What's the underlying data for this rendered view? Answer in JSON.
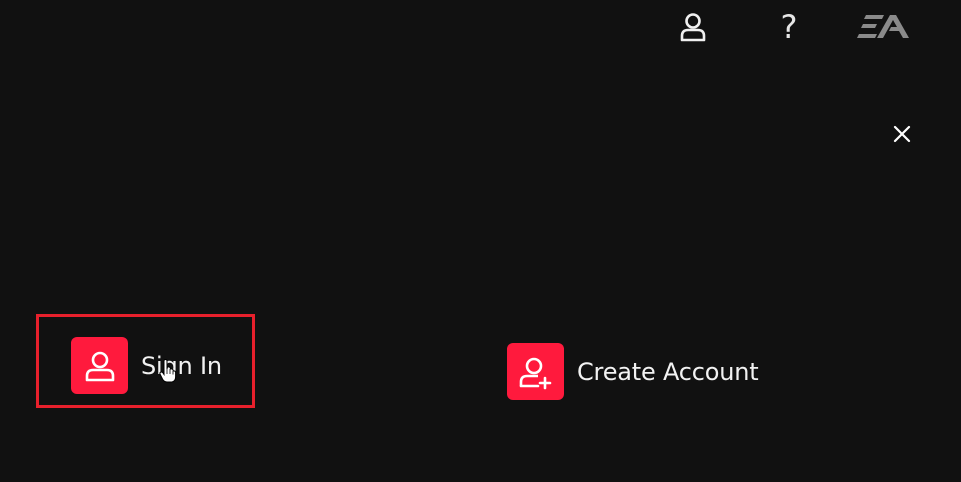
{
  "topbar": {
    "account_icon": "account-icon",
    "help_label": "?",
    "logo_text": "EA"
  },
  "close_icon": "close-icon",
  "options": {
    "sign_in": {
      "label": "Sign In",
      "icon": "user-icon"
    },
    "create_account": {
      "label": "Create Account",
      "icon": "user-add-icon"
    }
  },
  "colors": {
    "background": "#111111",
    "accent": "#ff1a3d",
    "highlight": "#e8202c",
    "text": "#f2f2f2"
  }
}
